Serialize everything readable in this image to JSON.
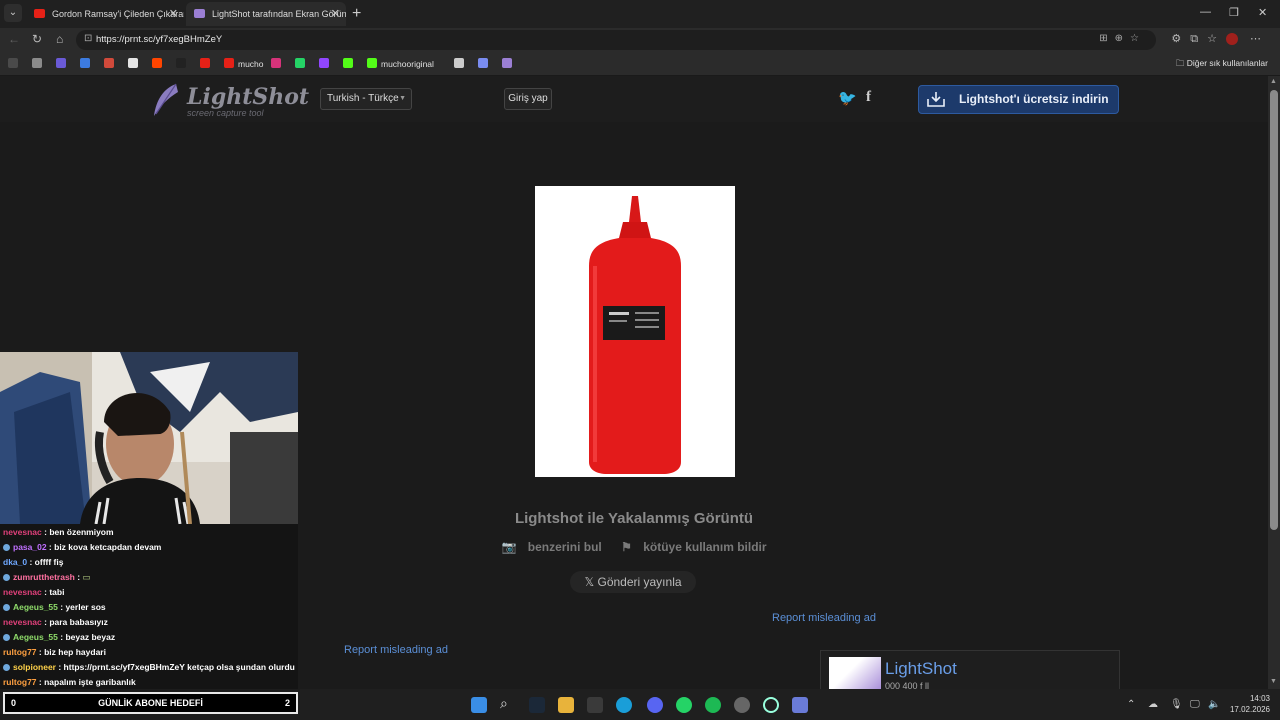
{
  "browser": {
    "tabs": [
      {
        "title": "Gordon Ramsay'i Çileden Çıkaran",
        "favicon_color": "#e62117",
        "active": false
      },
      {
        "title": "LightShot tarafından Ekran Görünt",
        "favicon_color": "#9b7fd4",
        "active": true
      }
    ],
    "url": "https://prnt.sc/yf7xegBHmZeY",
    "bookmarks": [
      {
        "label": "",
        "color": "#4a4a4a"
      },
      {
        "label": "",
        "color": "#8b8b8b"
      },
      {
        "label": "",
        "color": "#6a5ad6"
      },
      {
        "label": "",
        "color": "#3c7be0"
      },
      {
        "label": "",
        "color": "#d14a3b"
      },
      {
        "label": "",
        "color": "#e5e5e5"
      },
      {
        "label": "",
        "color": "#ff4500"
      },
      {
        "label": "",
        "color": "#222222"
      },
      {
        "label": "",
        "color": "#e62117"
      },
      {
        "label": "mucho",
        "color": "#e62117"
      },
      {
        "label": "",
        "color": "#d6337a"
      },
      {
        "label": "",
        "color": "#25d366"
      },
      {
        "label": "",
        "color": "#9146ff"
      },
      {
        "label": "",
        "color": "#53fc18"
      },
      {
        "label": "muchooriginal",
        "color": "#53fc18"
      },
      {
        "label": "",
        "color": "#cccccc"
      },
      {
        "label": "",
        "color": "#7a8cf0"
      },
      {
        "label": "",
        "color": "#9b7fd4"
      }
    ],
    "other_bookmarks": "Diğer sık kullanılanlar"
  },
  "lightshot": {
    "logo_text": "LightShot",
    "logo_sub": "screen capture tool",
    "language": "Turkish - Türkçe",
    "login": "Giriş yap",
    "social": {
      "twitter": "🐦",
      "facebook": "f"
    },
    "download_button": "Lightshot'ı ücretsiz indirin",
    "image_title": "Lightshot ile Yakalanmış Görüntü",
    "similar_link": "benzerini bul",
    "report_link": "kötüye kullanım bildir",
    "share_button": "Gönderi yayınla",
    "report_ad_1": "Report misleading ad",
    "report_ad_2": "Report misleading ad",
    "promo_name": "LightShot",
    "promo_sub": "000 400 f ll"
  },
  "stream": {
    "chat": [
      {
        "user": "nevesnac",
        "color": "#e0407a",
        "text": "ben özenmiyom",
        "badge": false
      },
      {
        "user": "pasa_02",
        "color": "#c070ff",
        "text": "biz kova ketcapdan devam",
        "badge": true
      },
      {
        "user": "dka_0",
        "color": "#6fa8ff",
        "text": "offff fiş",
        "badge": false
      },
      {
        "user": "zumrutthetrash",
        "color": "#ff70a0",
        "text": "",
        "badge": true
      },
      {
        "user": "nevesnac",
        "color": "#e0407a",
        "text": "tabi",
        "badge": false
      },
      {
        "user": "Aegeus_55",
        "color": "#8fdc6a",
        "text": "yerler sos",
        "badge": true
      },
      {
        "user": "nevesnac",
        "color": "#e0407a",
        "text": "para babasıyız",
        "badge": false
      },
      {
        "user": "Aegeus_55",
        "color": "#8fdc6a",
        "text": "beyaz beyaz",
        "badge": true
      },
      {
        "user": "rultog77",
        "color": "#ffa040",
        "text": "biz hep haydari",
        "badge": false
      },
      {
        "user": "solpioneer",
        "color": "#ffd24a",
        "text": "https://prnt.sc/yf7xegBHmZeY ketçap olsa şundan olurdu",
        "badge": true
      },
      {
        "user": "rultog77",
        "color": "#ffa040",
        "text": "napalım işte garibanlık",
        "badge": false
      }
    ],
    "sub_goal_label": "GÜNLİK ABONE HEDEFİ",
    "sub_goal_current": "0",
    "sub_goal_target": "2"
  },
  "taskbar": {
    "time": "14:03",
    "date": "17.02.2026"
  }
}
